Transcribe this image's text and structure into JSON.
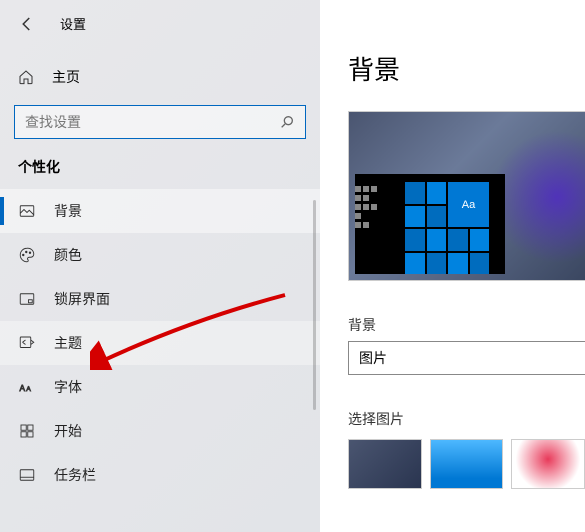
{
  "header": {
    "title": "设置"
  },
  "home": {
    "label": "主页"
  },
  "search": {
    "placeholder": "查找设置"
  },
  "section": {
    "label": "个性化"
  },
  "nav": [
    {
      "id": "background",
      "label": "背景"
    },
    {
      "id": "colors",
      "label": "颜色"
    },
    {
      "id": "lockscreen",
      "label": "锁屏界面"
    },
    {
      "id": "themes",
      "label": "主题"
    },
    {
      "id": "fonts",
      "label": "字体"
    },
    {
      "id": "start",
      "label": "开始"
    },
    {
      "id": "taskbar",
      "label": "任务栏"
    }
  ],
  "content": {
    "title": "背景",
    "preview_sample_text": "Aa",
    "bg_label": "背景",
    "bg_value": "图片",
    "choose_label": "选择图片"
  }
}
